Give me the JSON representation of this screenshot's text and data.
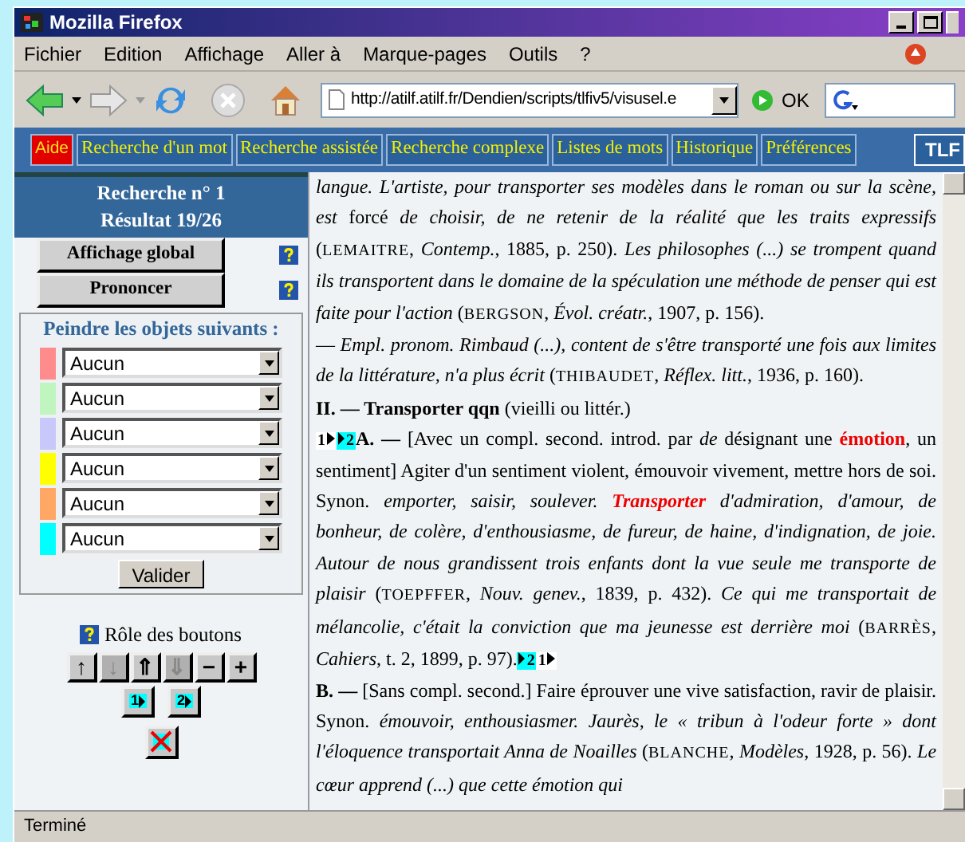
{
  "window": {
    "title": "Mozilla Firefox"
  },
  "menu": [
    "Fichier",
    "Edition",
    "Affichage",
    "Aller à",
    "Marque-pages",
    "Outils",
    "?"
  ],
  "toolbar": {
    "url": "http://atilf.atilf.fr/Dendien/scripts/tlfiv5/visusel.e",
    "go_label": "OK"
  },
  "site_nav": [
    {
      "label": "Aide",
      "kind": "help"
    },
    {
      "label": "Recherche d'un mot",
      "kind": "tab"
    },
    {
      "label": "Recherche assistée",
      "kind": "tab"
    },
    {
      "label": "Recherche complexe",
      "kind": "tab"
    },
    {
      "label": "Listes de mots",
      "kind": "tab"
    },
    {
      "label": "Historique",
      "kind": "tab"
    },
    {
      "label": "Préférences",
      "kind": "tab"
    }
  ],
  "logo": "TLF",
  "sidebar": {
    "heading": [
      "Recherche n° 1",
      "Résultat 19/26"
    ],
    "actions": [
      "Affichage global",
      "Prononcer"
    ],
    "paint": {
      "title": "Peindre les objets suivants :",
      "rows": [
        {
          "color": "#ff8c8c",
          "value": "Aucun"
        },
        {
          "color": "#c0f5c0",
          "value": "Aucun"
        },
        {
          "color": "#c8c8fa",
          "value": "Aucun"
        },
        {
          "color": "#ffff00",
          "value": "Aucun"
        },
        {
          "color": "#ffa866",
          "value": "Aucun"
        },
        {
          "color": "#00ffff",
          "value": "Aucun"
        }
      ],
      "submit": "Valider"
    },
    "buttons_help": "Rôle des boutons",
    "nav_buttons": [
      {
        "label": "↑",
        "disabled": false
      },
      {
        "label": "↓",
        "disabled": true
      },
      {
        "label": "⇑",
        "disabled": false
      },
      {
        "label": "⇓",
        "disabled": true
      },
      {
        "label": "−",
        "disabled": false
      },
      {
        "label": "+",
        "disabled": false
      }
    ],
    "level_buttons": [
      "1",
      "2"
    ]
  },
  "article": [
    [
      {
        "kind": "italic",
        "text": "langue. L'artiste, pour transporter ses modèles dans le roman ou sur la scène, est "
      },
      {
        "kind": "plain",
        "text": "forcé"
      },
      {
        "kind": "italic",
        "text": " de choisir, de ne retenir de la réalité que les traits expressifs"
      },
      {
        "kind": "plain",
        "text": " ("
      },
      {
        "kind": "caps",
        "text": "LEMAITRE"
      },
      {
        "kind": "plain",
        "text": ", "
      },
      {
        "kind": "italic",
        "text": "Contemp."
      },
      {
        "kind": "plain",
        "text": ", 1885, p. 250). "
      },
      {
        "kind": "italic",
        "text": "Les philosophes (...) se trompent quand ils transportent dans le domaine de la spéculation une méthode de penser qui est faite pour l'action"
      },
      {
        "kind": "plain",
        "text": " ("
      },
      {
        "kind": "caps",
        "text": "BERGSON"
      },
      {
        "kind": "plain",
        "text": ", "
      },
      {
        "kind": "italic",
        "text": "Évol. créatr."
      },
      {
        "kind": "plain",
        "text": ", 1907, p. 156)."
      }
    ],
    [
      {
        "kind": "plain",
        "text": "— "
      },
      {
        "kind": "italic",
        "text": "Empl. pronom. Rimbaud (...), content de s'être transporté une fois aux limites de la littérature, n'a plus écrit"
      },
      {
        "kind": "plain",
        "text": " ("
      },
      {
        "kind": "caps",
        "text": "THIBAUDET"
      },
      {
        "kind": "plain",
        "text": ", "
      },
      {
        "kind": "italic",
        "text": "Réflex. litt."
      },
      {
        "kind": "plain",
        "text": ", 1936, p. 160)."
      }
    ],
    [
      {
        "kind": "bold",
        "text": "II. — Transporter qqn"
      },
      {
        "kind": "plain",
        "text": " (vieilli ou littér.)"
      }
    ],
    [
      {
        "kind": "marker",
        "text": "1"
      },
      {
        "kind": "marker_hl",
        "text": "2"
      },
      {
        "kind": "bold",
        "text": "A. — "
      },
      {
        "kind": "plain",
        "text": "[Avec un compl. second. introd. par "
      },
      {
        "kind": "italic",
        "text": "de"
      },
      {
        "kind": "plain",
        "text": " désignant une "
      },
      {
        "kind": "red",
        "text": "émotion"
      },
      {
        "kind": "plain",
        "text": ", un sentiment] Agiter d'un sentiment violent, émouvoir vivement, mettre hors de soi. Synon. "
      },
      {
        "kind": "italic",
        "text": "emporter, saisir, soulever. "
      },
      {
        "kind": "red_italic",
        "text": "Transporter"
      },
      {
        "kind": "italic",
        "text": " d'admiration, d'amour, de bonheur, de colère, d'enthousiasme, de fureur, de haine, d'indignation, de joie. Autour de nous grandissent trois enfants dont la vue seule me transporte de plaisir"
      },
      {
        "kind": "plain",
        "text": " ("
      },
      {
        "kind": "caps",
        "text": "TOEPFFER"
      },
      {
        "kind": "plain",
        "text": ", "
      },
      {
        "kind": "italic",
        "text": "Nouv. genev."
      },
      {
        "kind": "plain",
        "text": ", 1839, p. 432). "
      },
      {
        "kind": "italic",
        "text": "Ce qui me transportait de mélancolie, c'était la conviction que ma jeunesse est derrière moi"
      },
      {
        "kind": "plain",
        "text": " ("
      },
      {
        "kind": "caps",
        "text": "BARRÈS"
      },
      {
        "kind": "plain",
        "text": ", "
      },
      {
        "kind": "italic",
        "text": "Cahiers"
      },
      {
        "kind": "plain",
        "text": ", t. 2, 1899, p. 97)."
      },
      {
        "kind": "marker_hl",
        "text": "2"
      },
      {
        "kind": "marker",
        "text": "1"
      }
    ],
    [
      {
        "kind": "bold",
        "text": "B. — "
      },
      {
        "kind": "plain",
        "text": "[Sans compl. second.] Faire éprouver une vive satisfaction, ravir de plaisir. Synon. "
      },
      {
        "kind": "italic",
        "text": "émouvoir, enthousiasmer. Jaurès, le « tribun à l'odeur forte » dont l'éloquence transportait Anna de Noailles"
      },
      {
        "kind": "plain",
        "text": " ("
      },
      {
        "kind": "caps",
        "text": "BLANCHE"
      },
      {
        "kind": "plain",
        "text": ", "
      },
      {
        "kind": "italic",
        "text": "Modèles"
      },
      {
        "kind": "plain",
        "text": ", 1928, p. 56). "
      },
      {
        "kind": "italic",
        "text": "Le cœur apprend (...) que cette émotion qui"
      }
    ]
  ],
  "status_bar": "Terminé"
}
